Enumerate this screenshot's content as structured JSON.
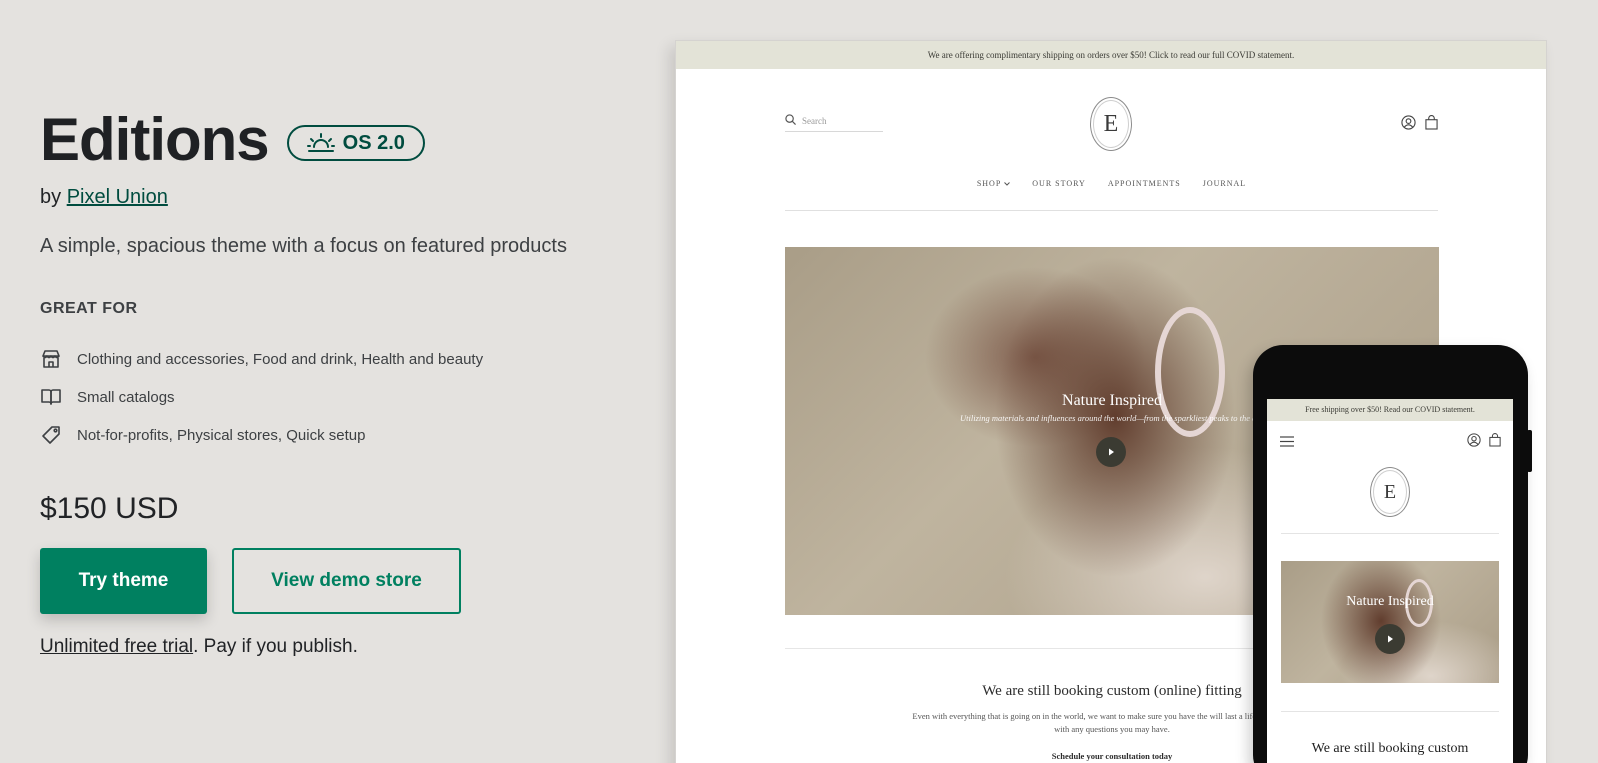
{
  "theme": {
    "name": "Editions",
    "os_badge": "OS 2.0",
    "by_prefix": "by",
    "author": "Pixel Union",
    "tagline": "A simple, spacious theme with a focus on featured products",
    "great_for_heading": "GREAT FOR",
    "features": [
      {
        "icon": "store-icon",
        "text": "Clothing and accessories, Food and drink, Health and beauty"
      },
      {
        "icon": "book-icon",
        "text": "Small catalogs"
      },
      {
        "icon": "tag-icon",
        "text": "Not-for-profits, Physical stores, Quick setup"
      }
    ],
    "price": "$150 USD",
    "try_button": "Try theme",
    "demo_button": "View demo store",
    "trial_link": "Unlimited free trial",
    "trial_suffix": ". Pay if you publish."
  },
  "colors": {
    "background": "#e4e2df",
    "primary": "#008060",
    "badge": "#004c3f",
    "announcement_bar": "#e3e3d7"
  },
  "desktop_preview": {
    "announcement": "We are offering complimentary shipping on orders over $50! Click to read our full COVID statement.",
    "search_placeholder": "Search",
    "logo_letter": "E",
    "nav": [
      "SHOP",
      "OUR STORY",
      "APPOINTMENTS",
      "JOURNAL"
    ],
    "hero_title": "Nature Inspired",
    "hero_subtitle": "Utilizing materials and influences around the world—from the sparkliest peaks to the dar",
    "content_heading": "We are still booking custom (online) fitting",
    "content_body": "Even with everything that is going on in the world, we want to make sure you have the will last a lifetime. Contact us with any questions you may have.",
    "content_cta": "Schedule your consultation today"
  },
  "mobile_preview": {
    "announcement": "Free shipping over $50! Read our COVID statement.",
    "logo_letter": "E",
    "hero_title": "Nature Inspired",
    "content_heading": "We are still booking custom"
  }
}
